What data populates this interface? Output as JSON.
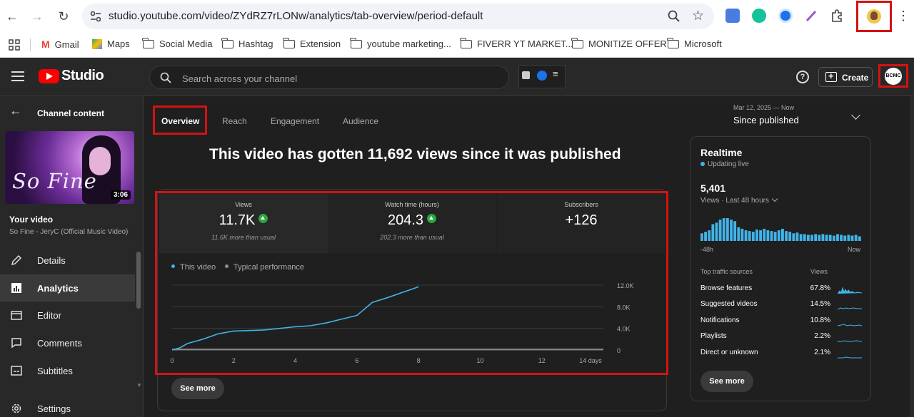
{
  "browser": {
    "url": "studio.youtube.com/video/ZYdRZ7rLONw/analytics/tab-overview/period-default",
    "bookmarks": [
      "Gmail",
      "Maps",
      "Social Media",
      "Hashtag",
      "Extension",
      "youtube marketing...",
      "FIVERR YT MARKET...",
      "MONITIZE OFFER",
      "Microsoft"
    ]
  },
  "header": {
    "brand": "Studio",
    "search_placeholder": "Search across your channel",
    "create_label": "Create",
    "avatar_text": "BCMC"
  },
  "sidebar": {
    "back_label": "Channel content",
    "thumbnail_text": "So Fine",
    "duration": "3:06",
    "your_video_label": "Your video",
    "video_title": "So Fine - JeryC (Official Music Video)",
    "items": [
      {
        "label": "Details",
        "icon": "pencil-icon"
      },
      {
        "label": "Analytics",
        "icon": "analytics-icon"
      },
      {
        "label": "Editor",
        "icon": "clapper-icon"
      },
      {
        "label": "Comments",
        "icon": "comment-icon"
      },
      {
        "label": "Subtitles",
        "icon": "subtitles-icon"
      },
      {
        "label": "Settings",
        "icon": "gear-icon"
      }
    ]
  },
  "tabs": [
    "Overview",
    "Reach",
    "Engagement",
    "Audience"
  ],
  "date": {
    "range": "Mar 12, 2025 — Now",
    "label": "Since published"
  },
  "headline": "This video has gotten 11,692 views since it was published",
  "metrics": [
    {
      "label": "Views",
      "value": "11.7K",
      "sub": "11.6K more than usual"
    },
    {
      "label": "Watch time (hours)",
      "value": "204.3",
      "sub": "202.3 more than usual"
    },
    {
      "label": "Subscribers",
      "value": "+126",
      "sub": ""
    }
  ],
  "see_more": "See more",
  "chart_data": {
    "type": "line",
    "series": [
      {
        "name": "This video",
        "color": "#41b4e9",
        "x": [
          0,
          0.25,
          0.5,
          1,
          1.5,
          2,
          3,
          3.5,
          4,
          4.5,
          5,
          5.5,
          6,
          6.5,
          7,
          7.5,
          8
        ],
        "y": [
          0,
          400,
          1200,
          2000,
          3000,
          3500,
          3700,
          4000,
          4300,
          4500,
          5000,
          5700,
          6400,
          8800,
          9700,
          10700,
          11692
        ]
      },
      {
        "name": "Typical performance",
        "color": "#909090",
        "x": [
          0,
          14
        ],
        "y": [
          0,
          0
        ]
      }
    ],
    "x_ticks": [
      "0",
      "2",
      "4",
      "6",
      "8",
      "10",
      "12",
      "14 days"
    ],
    "y_ticks": [
      "12.0K",
      "8.0K",
      "4.0K",
      "0"
    ],
    "xlim": [
      0,
      14
    ],
    "ylim": [
      0,
      12000
    ],
    "grid": true,
    "legend": "top-left"
  },
  "realtime": {
    "title": "Realtime",
    "live_label": "Updating live",
    "count": "5,401",
    "period_label": "Views · Last 48 hours",
    "axis_start": "-48h",
    "axis_end": "Now",
    "bar_values": [
      10,
      12,
      14,
      22,
      24,
      28,
      30,
      30,
      28,
      26,
      18,
      16,
      14,
      13,
      12,
      15,
      14,
      16,
      14,
      13,
      12,
      14,
      16,
      13,
      12,
      10,
      11,
      9,
      9,
      8,
      8,
      9,
      8,
      9,
      8,
      8,
      7,
      9,
      8,
      7,
      8,
      7,
      8,
      6
    ],
    "sources_head": "Top traffic sources",
    "views_head": "Views",
    "sources": [
      {
        "name": "Browse features",
        "pct": "67.8%"
      },
      {
        "name": "Suggested videos",
        "pct": "14.5%"
      },
      {
        "name": "Notifications",
        "pct": "10.8%"
      },
      {
        "name": "Playlists",
        "pct": "2.2%"
      },
      {
        "name": "Direct or unknown",
        "pct": "2.1%"
      }
    ]
  }
}
